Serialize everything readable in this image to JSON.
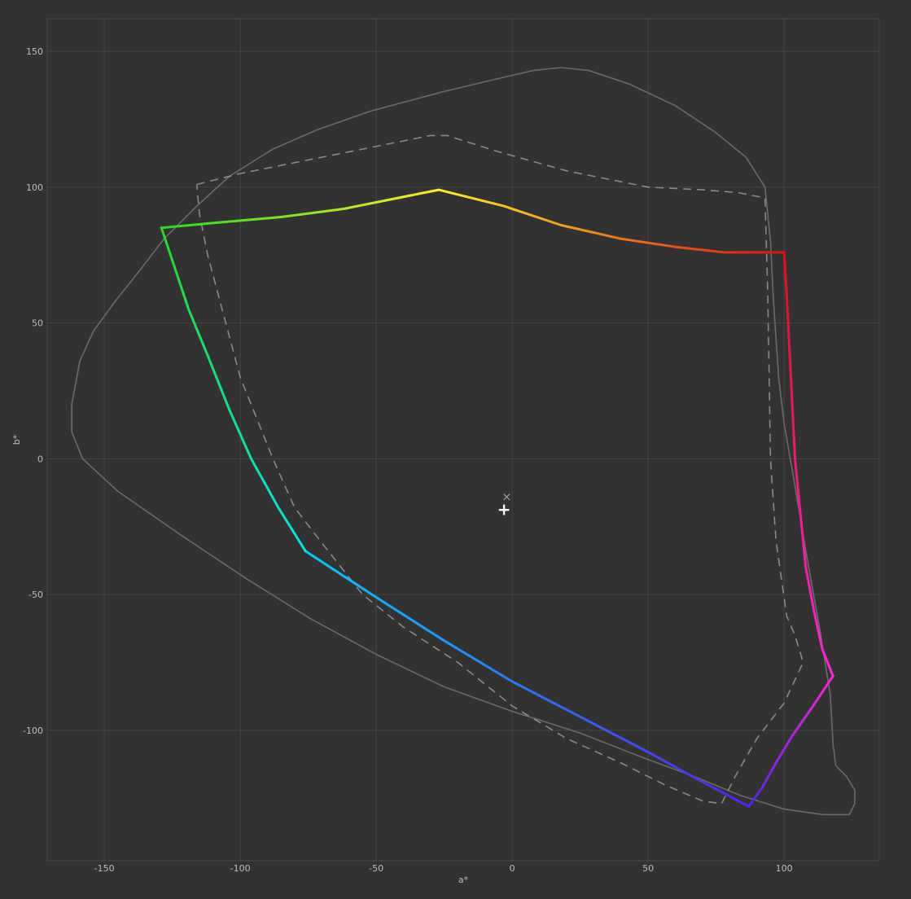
{
  "chart_data": {
    "type": "line",
    "title": "",
    "xlabel": "a*",
    "ylabel": "b*",
    "xlim": [
      -171,
      135
    ],
    "ylim": [
      -148,
      162
    ],
    "x_ticks": [
      -150,
      -100,
      -50,
      0,
      50,
      100
    ],
    "y_ticks": [
      150,
      100,
      50,
      0,
      -50,
      -100
    ],
    "grid": true,
    "colors": {
      "background": "#323232",
      "grid": "#454545",
      "tick_text": "#bdbdbd",
      "reference_outline": "#6a6a6a",
      "dashed_gamut": "#8a8a8a",
      "marker": "#ffffff",
      "marker_x": "#9a9a9a"
    },
    "series": [
      {
        "style": "solid-gray",
        "points": [
          [
            -162,
            20
          ],
          [
            -159,
            36
          ],
          [
            -154,
            47
          ],
          [
            -146,
            58
          ],
          [
            -138,
            68
          ],
          [
            -128,
            81
          ],
          [
            -116,
            93
          ],
          [
            -104,
            104
          ],
          [
            -88,
            114
          ],
          [
            -72,
            121
          ],
          [
            -52,
            128
          ],
          [
            -26,
            135
          ],
          [
            -5,
            140
          ],
          [
            8,
            143
          ],
          [
            18,
            144
          ],
          [
            28,
            143
          ],
          [
            43,
            138
          ],
          [
            60,
            130
          ],
          [
            75,
            120
          ],
          [
            86,
            111
          ],
          [
            93,
            100
          ],
          [
            95,
            80
          ],
          [
            96,
            60
          ],
          [
            98,
            30
          ],
          [
            100,
            13
          ],
          [
            104,
            -10
          ],
          [
            108,
            -34
          ],
          [
            113,
            -62
          ],
          [
            117,
            -87
          ],
          [
            118,
            -105
          ],
          [
            119,
            -113
          ],
          [
            123,
            -117
          ],
          [
            126,
            -122
          ],
          [
            126,
            -127
          ],
          [
            124,
            -131
          ],
          [
            114,
            -131
          ],
          [
            100,
            -129
          ],
          [
            84,
            -124
          ],
          [
            67,
            -117
          ],
          [
            48,
            -110
          ],
          [
            25,
            -101
          ],
          [
            0,
            -93
          ],
          [
            -25,
            -84
          ],
          [
            -50,
            -72
          ],
          [
            -74,
            -59
          ],
          [
            -98,
            -44
          ],
          [
            -122,
            -28
          ],
          [
            -145,
            -12
          ],
          [
            -158,
            0
          ],
          [
            -162,
            10
          ],
          [
            -162,
            20
          ]
        ]
      },
      {
        "style": "dashed-gray",
        "points": [
          [
            -116,
            101
          ],
          [
            -100,
            105
          ],
          [
            -85,
            108
          ],
          [
            -65,
            112
          ],
          [
            -45,
            116
          ],
          [
            -30,
            119
          ],
          [
            -24,
            119
          ],
          [
            -5,
            113
          ],
          [
            20,
            106
          ],
          [
            50,
            100
          ],
          [
            70,
            99
          ],
          [
            83,
            98
          ],
          [
            93,
            96
          ],
          [
            94,
            60
          ],
          [
            95,
            0
          ],
          [
            97,
            -30
          ],
          [
            101,
            -58
          ],
          [
            104,
            -65
          ],
          [
            107,
            -75
          ],
          [
            100,
            -90
          ],
          [
            90,
            -103
          ],
          [
            82,
            -117
          ],
          [
            77,
            -127
          ],
          [
            70,
            -126
          ],
          [
            56,
            -120
          ],
          [
            40,
            -112
          ],
          [
            20,
            -103
          ],
          [
            0,
            -91
          ],
          [
            -20,
            -75
          ],
          [
            -40,
            -62
          ],
          [
            -55,
            -50
          ],
          [
            -70,
            -31
          ],
          [
            -80,
            -18
          ],
          [
            -88,
            0
          ],
          [
            -100,
            30
          ],
          [
            -108,
            60
          ],
          [
            -112,
            75
          ],
          [
            -115,
            90
          ],
          [
            -116,
            101
          ]
        ]
      },
      {
        "style": "rainbow-gamut",
        "segments": [
          {
            "from": "#22dd22",
            "to": "#ffee22",
            "points": [
              [
                -129,
                85
              ],
              [
                -108,
                87
              ],
              [
                -85,
                89
              ],
              [
                -62,
                92
              ],
              [
                -42,
                96
              ],
              [
                -27,
                99
              ]
            ]
          },
          {
            "from": "#ffee22",
            "to": "#dd1111",
            "points": [
              [
                -27,
                99
              ],
              [
                -3,
                93
              ],
              [
                18,
                86
              ],
              [
                40,
                81
              ],
              [
                60,
                78
              ],
              [
                78,
                76
              ],
              [
                92,
                76
              ],
              [
                100,
                76
              ]
            ]
          },
          {
            "from": "#dd1111",
            "to": "#ff22dd",
            "points": [
              [
                100,
                76
              ],
              [
                101,
                60
              ],
              [
                102,
                40
              ],
              [
                103,
                20
              ],
              [
                104,
                0
              ],
              [
                106,
                -20
              ],
              [
                108,
                -40
              ],
              [
                111,
                -56
              ],
              [
                114,
                -70
              ],
              [
                118,
                -80
              ]
            ]
          },
          {
            "from": "#ff22dd",
            "to": "#5522ee",
            "points": [
              [
                118,
                -80
              ],
              [
                110,
                -92
              ],
              [
                103,
                -102
              ],
              [
                97,
                -112
              ],
              [
                92,
                -121
              ],
              [
                87,
                -128
              ]
            ]
          },
          {
            "from": "#5522ee",
            "to": "#00ccff",
            "points": [
              [
                87,
                -128
              ],
              [
                70,
                -119
              ],
              [
                50,
                -108
              ],
              [
                25,
                -95
              ],
              [
                0,
                -82
              ],
              [
                -25,
                -67
              ],
              [
                -50,
                -51
              ],
              [
                -76,
                -34
              ]
            ]
          },
          {
            "from": "#00e5e5",
            "to": "#22dd22",
            "points": [
              [
                -76,
                -34
              ],
              [
                -86,
                -18
              ],
              [
                -96,
                0
              ],
              [
                -104,
                18
              ],
              [
                -112,
                38
              ],
              [
                -119,
                55
              ],
              [
                -124,
                70
              ],
              [
                -129,
                85
              ]
            ]
          }
        ]
      }
    ],
    "markers": [
      {
        "symbol": "×",
        "x": -2,
        "y": -14
      },
      {
        "symbol": "+",
        "x": -3,
        "y": -19
      }
    ]
  }
}
